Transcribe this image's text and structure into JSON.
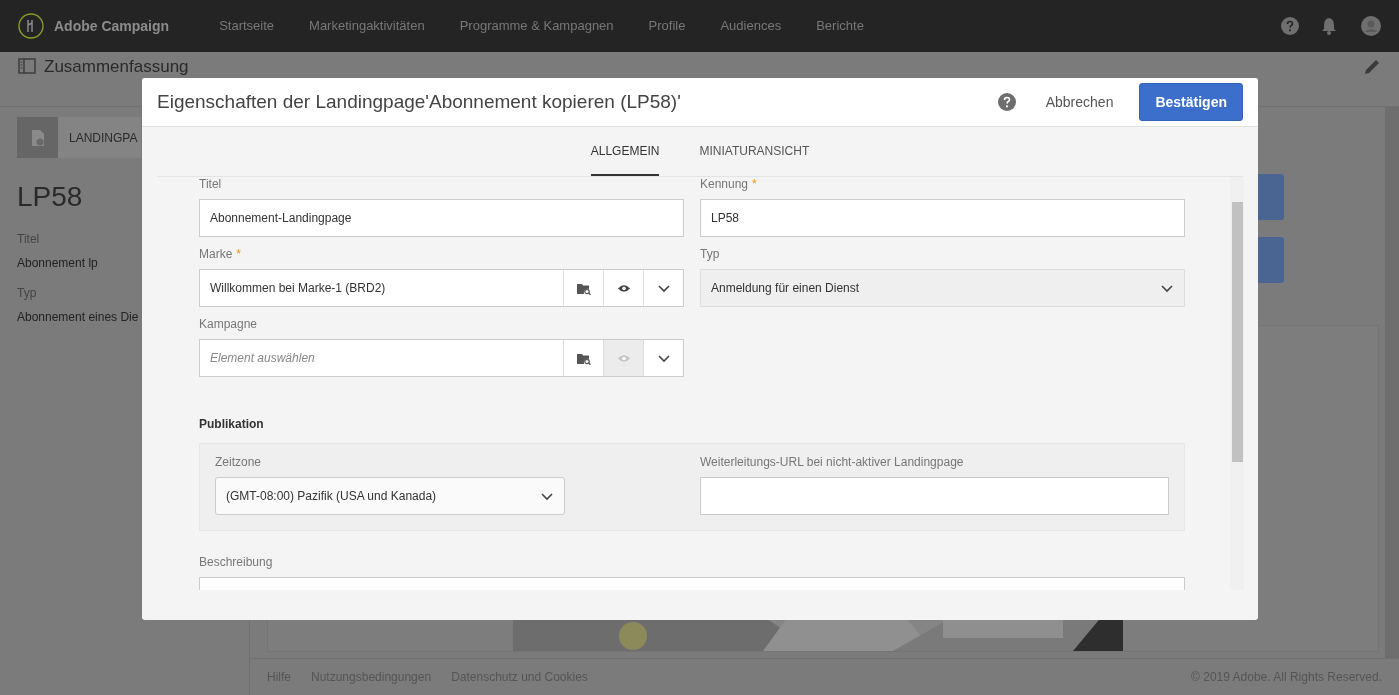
{
  "app": {
    "name": "Adobe Campaign",
    "nav": [
      "Startseite",
      "Marketingaktivitäten",
      "Programme & Kampagnen",
      "Profile",
      "Audiences",
      "Berichte"
    ]
  },
  "page": {
    "heading": "Zusammenfassung",
    "badge": "LANDINGPA",
    "id": "LP58",
    "fields": [
      {
        "label": "Titel",
        "value": "Abonnement lp"
      },
      {
        "label": "Typ",
        "value": "Abonnement eines Die"
      }
    ]
  },
  "footer": {
    "links": [
      "Hilfe",
      "Nutzungsbedingungen",
      "Datenschutz und Cookies"
    ],
    "copyright": "© 2019 Adobe. All Rights Reserved."
  },
  "dialog": {
    "title": "Eigenschaften der Landingpage'Abonnement kopieren (LP58)'",
    "cancel": "Abbrechen",
    "confirm": "Bestätigen",
    "tabs": [
      {
        "label": "ALLGEMEIN",
        "selected": true
      },
      {
        "label": "MINIATURANSICHT",
        "selected": false
      }
    ],
    "fields": [
      {
        "kind": "text",
        "label": "Titel",
        "value": "Abonnement-Landingpage"
      },
      {
        "kind": "text",
        "label": "Kennung",
        "required_mark": "*",
        "value": "LP58"
      },
      {
        "kind": "picker",
        "label": "Marke",
        "required_mark": "*",
        "value": "Willkommen bei Marke-1 (BRD2)",
        "preview_enabled": true
      },
      {
        "kind": "select",
        "label": "Typ",
        "value": "Anmeldung für einen Dienst"
      },
      {
        "kind": "picker",
        "label": "Kampagne",
        "placeholder": "Element auswählen",
        "preview_enabled": false
      }
    ],
    "publication": {
      "heading": "Publikation",
      "fields": [
        {
          "kind": "select",
          "label": "Zeitzone",
          "value": "(GMT-08:00) Pazifik (USA und Kanada)"
        },
        {
          "kind": "text",
          "label": "Weiterleitungs-URL bei nicht-aktiver Landingpage"
        }
      ]
    },
    "description": {
      "label": "Beschreibung"
    }
  }
}
